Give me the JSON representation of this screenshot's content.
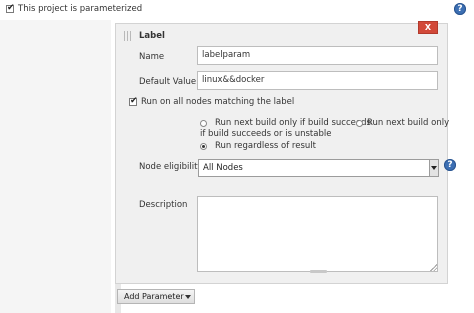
{
  "parameterized": {
    "label": "This project is parameterized",
    "checked": true
  },
  "help_icon_glyph": "?",
  "param_panel": {
    "title": "Label",
    "close_label": "X",
    "name_label": "Name",
    "name_value": "labelparam",
    "default_value_label": "Default Value",
    "default_value": "linux&&docker",
    "run_on_all_nodes_label": "Run on all nodes matching the label",
    "run_on_all_nodes_checked": true,
    "radio_options": [
      "Run next build only if build succeeds",
      "Run next build only if build succeeds or is unstable",
      "Run regardless of result"
    ],
    "radio_option_2_line1": "Run next build only",
    "radio_option_2_line2": "if build succeeds or is unstable",
    "radio_selected_index": 2,
    "node_eligibility_label": "Node eligibility",
    "node_eligibility_value": "All Nodes",
    "description_label": "Description",
    "description_value": ""
  },
  "add_parameter_label": "Add Parameter",
  "colors": {
    "close_button": "#d24939",
    "help_icon": "#3c6fb3",
    "panel_bg": "#f0f0f0"
  }
}
